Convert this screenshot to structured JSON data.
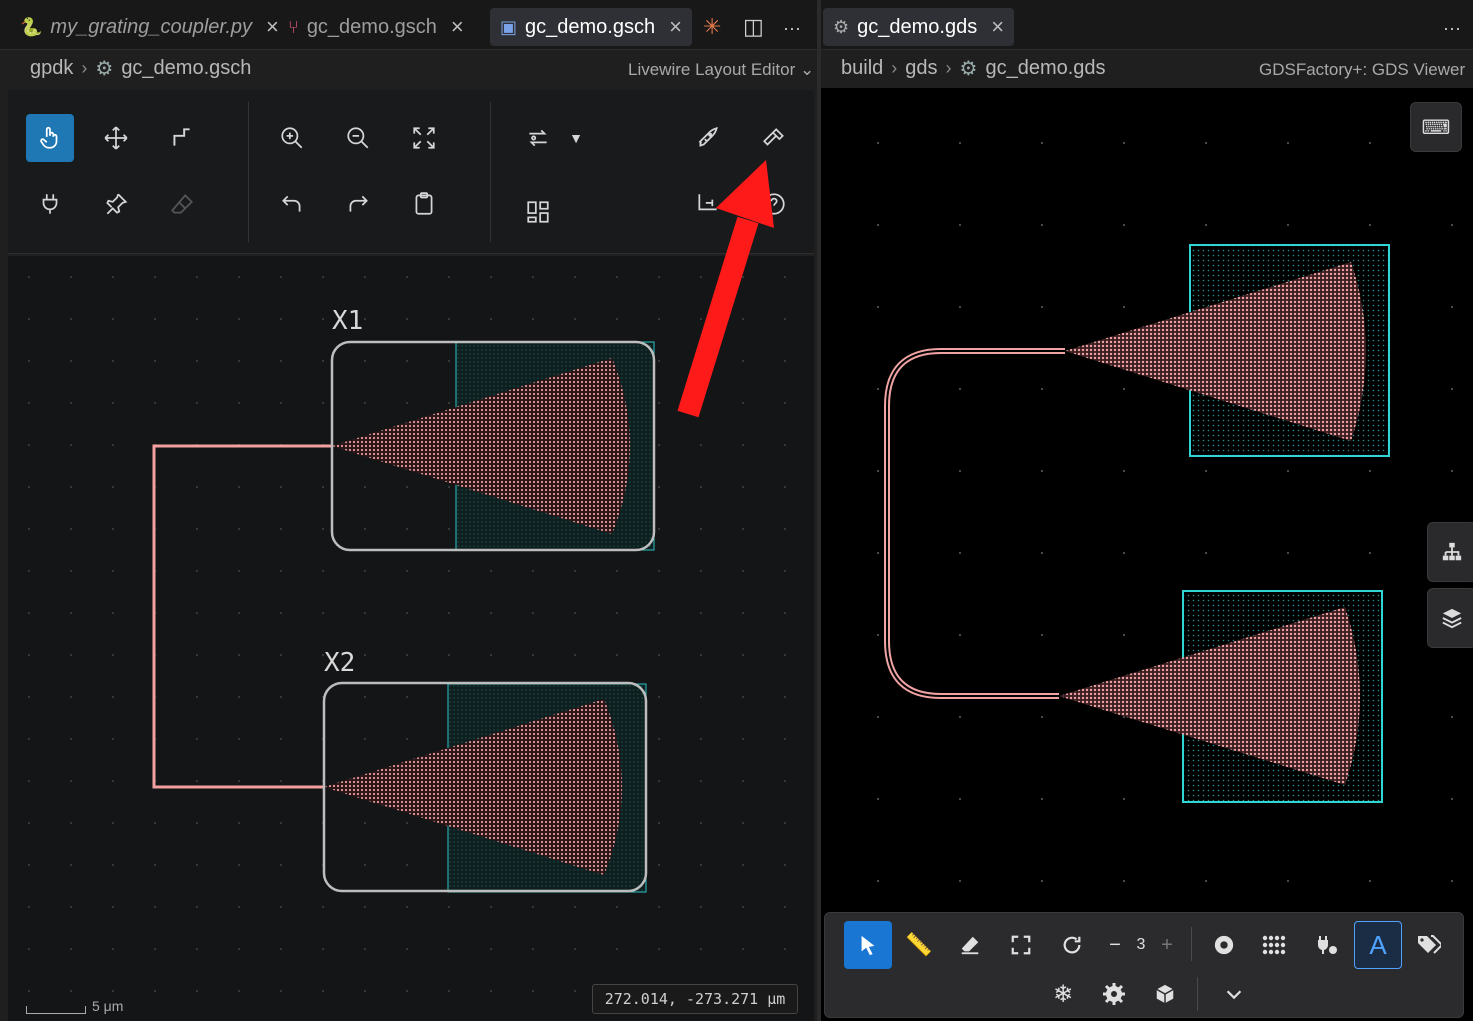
{
  "left_pane": {
    "tabs": [
      {
        "label": "my_grating_coupler.py",
        "icon": "python-icon",
        "italic": true
      },
      {
        "label": "gc_demo.gsch",
        "icon": "schematic-icon",
        "italic": false
      },
      {
        "label": "gc_demo.gsch",
        "icon": "schematic-icon",
        "italic": false,
        "active": true
      }
    ],
    "close_glyph": "×",
    "more_glyph": "···",
    "breadcrumb": [
      "gpdk",
      "gc_demo.gsch"
    ],
    "editor_name": "Livewire Layout Editor",
    "toolbar": {
      "tools": [
        "hand-pointer",
        "move",
        "route",
        "connect",
        "pin",
        "eraser",
        "zoom-in",
        "zoom-out",
        "fit",
        "undo",
        "redo",
        "clipboard",
        "swap",
        "layout-grid",
        "run",
        "build",
        "route-branch",
        "help"
      ],
      "active_tool": "hand-pointer"
    },
    "canvas": {
      "instances": [
        {
          "name": "X1"
        },
        {
          "name": "X2"
        }
      ]
    },
    "scale_label": "5 μm",
    "coordinates": "272.014, -273.271 μm"
  },
  "right_pane": {
    "tab": {
      "label": "gc_demo.gds",
      "icon": "chip-icon"
    },
    "breadcrumb": [
      "build",
      "gds",
      "gc_demo.gds"
    ],
    "viewer_name": "GDSFactory+: GDS Viewer",
    "bottom_toolbar": {
      "zoom_level": "3",
      "minus": "−",
      "plus": "+",
      "tools": [
        "select",
        "ruler",
        "eraser",
        "fit",
        "refresh",
        "target",
        "grid",
        "plug",
        "text",
        "tags",
        "snowflake",
        "settings",
        "3d-box",
        "expand"
      ]
    }
  },
  "annotation": {
    "color": "#ff1a1a",
    "points_to": "build-button"
  },
  "colors": {
    "accent": "#1f77b4",
    "wire": "#f4a0a0",
    "cell_outline": "#2ec4c4",
    "grating": "#e89a9a"
  }
}
